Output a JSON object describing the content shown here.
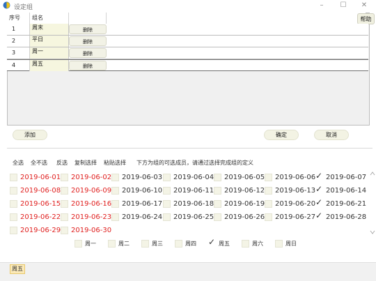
{
  "window": {
    "title": "设定组",
    "minimize_icon": "minimize-icon",
    "maximize_icon": "maximize-icon",
    "close_icon": "close-icon",
    "minimize_glyph": "–",
    "maximize_glyph": "☐",
    "close_glyph": "✕"
  },
  "table": {
    "headers": {
      "no": "序号",
      "name": "组名",
      "action": ""
    },
    "rows": [
      {
        "no": "1",
        "name": "周末",
        "action": "删除"
      },
      {
        "no": "2",
        "name": "平日",
        "action": "删除"
      },
      {
        "no": "3",
        "name": "周一",
        "action": "删除"
      },
      {
        "no": "4",
        "name": "周五",
        "action": "删除"
      }
    ],
    "selected_row": 4
  },
  "buttons": {
    "help": "帮助",
    "add": "添加",
    "ok": "确定",
    "cancel": "取消"
  },
  "toolbar": {
    "select_all": "全选",
    "select_none": "全不选",
    "invert": "反选",
    "copy": "复制选择",
    "paste": "粘贴选择",
    "hint": "下方为组的可选成员，请通过选择完成组的定义"
  },
  "dates": [
    {
      "label": "2019-06-01",
      "red": true,
      "checked": false
    },
    {
      "label": "2019-06-02",
      "red": true,
      "checked": false
    },
    {
      "label": "2019-06-03",
      "red": false,
      "checked": false
    },
    {
      "label": "2019-06-04",
      "red": false,
      "checked": false
    },
    {
      "label": "2019-06-05",
      "red": false,
      "checked": false
    },
    {
      "label": "2019-06-06",
      "red": false,
      "checked": false
    },
    {
      "label": "2019-06-07",
      "red": false,
      "checked": true
    },
    {
      "label": "2019-06-08",
      "red": true,
      "checked": false
    },
    {
      "label": "2019-06-09",
      "red": true,
      "checked": false
    },
    {
      "label": "2019-06-10",
      "red": false,
      "checked": false
    },
    {
      "label": "2019-06-11",
      "red": false,
      "checked": false
    },
    {
      "label": "2019-06-12",
      "red": false,
      "checked": false
    },
    {
      "label": "2019-06-13",
      "red": false,
      "checked": false
    },
    {
      "label": "2019-06-14",
      "red": false,
      "checked": true
    },
    {
      "label": "2019-06-15",
      "red": true,
      "checked": false
    },
    {
      "label": "2019-06-16",
      "red": true,
      "checked": false
    },
    {
      "label": "2019-06-17",
      "red": false,
      "checked": false
    },
    {
      "label": "2019-06-18",
      "red": false,
      "checked": false
    },
    {
      "label": "2019-06-19",
      "red": false,
      "checked": false
    },
    {
      "label": "2019-06-20",
      "red": false,
      "checked": false
    },
    {
      "label": "2019-06-21",
      "red": false,
      "checked": true
    },
    {
      "label": "2019-06-22",
      "red": true,
      "checked": false
    },
    {
      "label": "2019-06-23",
      "red": true,
      "checked": false
    },
    {
      "label": "2019-06-24",
      "red": false,
      "checked": false
    },
    {
      "label": "2019-06-25",
      "red": false,
      "checked": false
    },
    {
      "label": "2019-06-26",
      "red": false,
      "checked": false
    },
    {
      "label": "2019-06-27",
      "red": false,
      "checked": false
    },
    {
      "label": "2019-06-28",
      "red": false,
      "checked": true
    },
    {
      "label": "2019-06-29",
      "red": true,
      "checked": false
    },
    {
      "label": "2019-06-30",
      "red": true,
      "checked": false
    }
  ],
  "weekdays": [
    {
      "label": "周一",
      "checked": false
    },
    {
      "label": "周二",
      "checked": false
    },
    {
      "label": "周三",
      "checked": false
    },
    {
      "label": "周四",
      "checked": false
    },
    {
      "label": "周五",
      "checked": true
    },
    {
      "label": "周六",
      "checked": false
    },
    {
      "label": "周日",
      "checked": false
    }
  ],
  "status": {
    "current_group": "周五"
  },
  "colors": {
    "weekend": "#e0201f",
    "accent_cell": "#f6f6df",
    "status_highlight": "#fbe9b8"
  },
  "check_glyph": "✓"
}
